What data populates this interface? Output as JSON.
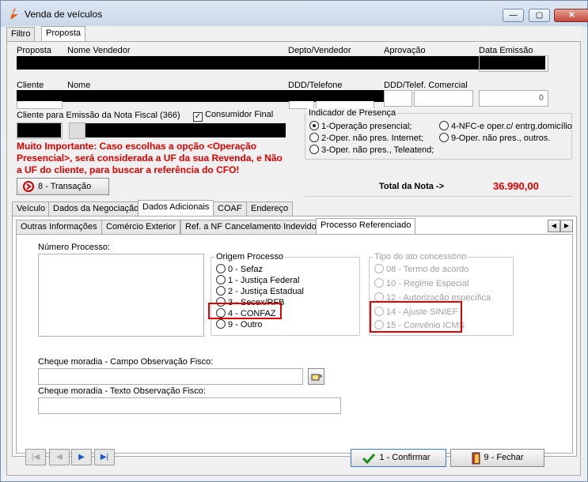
{
  "window": {
    "title": "Venda de veículos",
    "min_label": "—",
    "max_label": "▢",
    "close_label": "✕"
  },
  "top_tabs": [
    "Filtro",
    "Proposta"
  ],
  "header": {
    "proposta_label": "Proposta",
    "vendedor_label": "Nome Vendedor",
    "depto_label": "Depto/Vendedor",
    "aprovacao_label": "Aprovação",
    "data_emissao_label": "Data Emissão",
    "cliente_label": "Cliente",
    "nome_label": "Nome",
    "ddd_tel_label": "DDD/Telefone",
    "ddd_com_label": "DDD/Telef. Comercial",
    "comercial_value": "0",
    "cliente_nf_label": "Cliente para Emissão da Nota Fiscal (366)",
    "consumidor_final_label": "Consumidor Final",
    "consumidor_final_check": "✓"
  },
  "warning": "Muito Importante: Caso escolhas a opção <Operação Presencial>, será considerada a UF da sua Revenda, e Não a UF do cliente, para buscar a referência do CFO!",
  "indicador": {
    "title": "Indicador de Presença",
    "options": [
      "1-Operação presencial;",
      "4-NFC-e oper.c/ entrg.domicílio",
      "2-Oper. não pres. Internet;",
      "9-Oper. não pres., outros.",
      "3-Oper. não pres., Teleatend;"
    ]
  },
  "transacao_label": "8 - Transação",
  "total": {
    "label": "Total da Nota ->",
    "value": "36.990,00"
  },
  "sub_tabs": [
    "Veículo",
    "Dados da Negociação",
    "Dados Adicionais",
    "COAF",
    "Endereço"
  ],
  "inner_tabs": [
    "Outras Informações",
    "Comércio Exterior",
    "Ref. a NF Cancelamento Indevido",
    "Processo Referenciado"
  ],
  "processo": {
    "numero_label": "Número Processo:",
    "origem_title": "Origem Processo",
    "origem_options": [
      "0 - Sefaz",
      "1 - Justiça Federal",
      "2 - Justiça Estadual",
      "3 - Secex/RFB",
      "4 - CONFAZ",
      "9 - Outro"
    ],
    "tipo_title": "Tipo do ato concessório",
    "tipo_options": [
      "08 - Termo de acordo",
      "10 - Regime Especial",
      "12 - Autorização específica",
      "14 - Ajuste SINIEF",
      "15 - Convênio ICMS"
    ],
    "cheque_campo_label": "Cheque moradia - Campo Observação Fisco:",
    "cheque_texto_label": "Cheque moradia - Texto Observação Fisco:"
  },
  "footer": {
    "confirmar_label": "1 - Confirmar",
    "fechar_label": "9 - Fechar",
    "nav": [
      "|◀",
      "◀",
      "▶",
      "▶|"
    ]
  },
  "colors": {
    "warning_red": "#e00000",
    "highlight_red": "#e00000",
    "nav_blue": "#1a57c8"
  }
}
